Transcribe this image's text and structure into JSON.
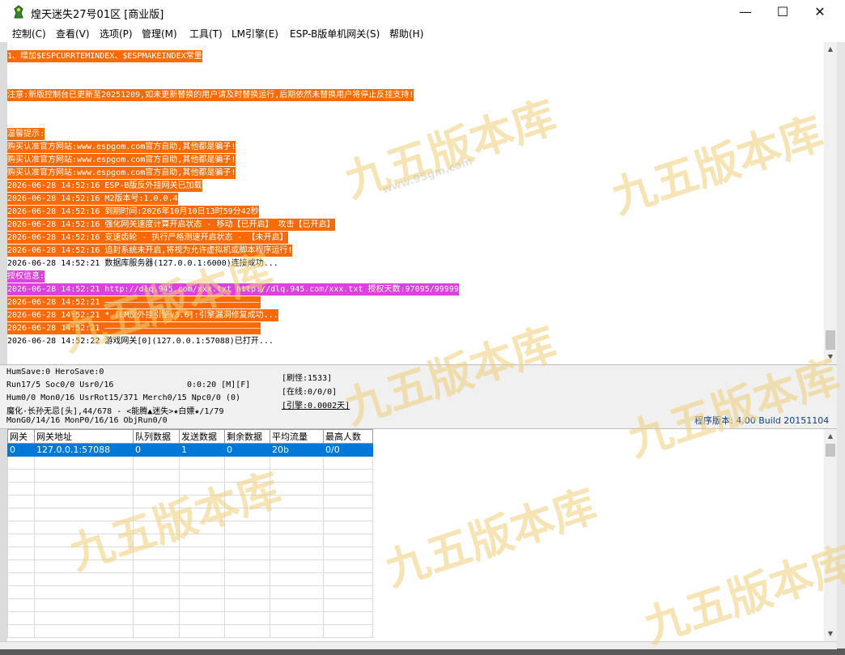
{
  "window": {
    "title": "煌天迷失27号01区 [商业版]",
    "minimize": "—",
    "maximize": "☐",
    "close": "✕"
  },
  "menu": [
    "控制(C)",
    "查看(V)",
    "选项(P)",
    "管理(M)",
    "工具(T)",
    "LM引擎(E)",
    "ESP-B版单机网关(S)",
    "帮助(H)"
  ],
  "log": [
    {
      "text": "1、增加$ESPCURRTEMINDEX、$ESPMAKEINDEX常量",
      "style": "o"
    },
    {
      "text": "",
      "style": "k"
    },
    {
      "text": "",
      "style": "k"
    },
    {
      "text": "注意:新版控制台已更新至20251209,如未更新替换的用户请及时替换运行,后期依然未替换用户将停止反挂支持!",
      "style": "o"
    },
    {
      "text": "",
      "style": "k"
    },
    {
      "text": "",
      "style": "k"
    },
    {
      "text": "温馨提示:",
      "style": "o"
    },
    {
      "text": "购买认准官方网站:www.espgom.com官方自助,其他都是骗子!",
      "style": "o"
    },
    {
      "text": "购买认准官方网站:www.espgom.com官方自助,其他都是骗子!",
      "style": "o"
    },
    {
      "text": "购买认准官方网站:www.espgom.com官方自助,其他都是骗子!",
      "style": "o"
    },
    {
      "text": "2026-06-28 14:52:16 ESP-B版反外挂网关已加载",
      "style": "o"
    },
    {
      "text": "2026-06-28 14:52:16 M2版本号:1.0.0.4",
      "style": "o"
    },
    {
      "text": "2026-06-28 14:52:16 到期时间:2026年10月10日13时59分42秒",
      "style": "o"
    },
    {
      "text": "2026-06-28 14:52:16 强化网关速度计算开启状态 - 移动【已开启】 攻击【已开启】",
      "style": "o"
    },
    {
      "text": "2026-06-28 14:52:16 变速齿轮 - 执行严格测速开启状态 - 【未开启】",
      "style": "o"
    },
    {
      "text": "2026-06-28 14:52:16 追封系统未开启,将视为允许虚拟机或脚本程序运行!",
      "style": "o"
    },
    {
      "text": "2026-06-28 14:52:21 数据库服务器(127.0.0.1:6000)连接成功...",
      "style": "k"
    },
    {
      "text": "授权信息:",
      "style": "m"
    },
    {
      "text": "2026-06-28 14:52:21 http://dlq.945.com/xxx.txt http://dlq.945.com/xxx.txt 授权天数:97095/99999",
      "style": "m"
    },
    {
      "text": "2026-06-28 14:52:21 ————————————————————————————————",
      "style": "o"
    },
    {
      "text": "2026-06-28 14:52:21 * [LM反外挂引擎v3.6]:引擎漏洞修复成功...",
      "style": "o"
    },
    {
      "text": "2026-06-28 14:52:21 ————————————————————————————————",
      "style": "o"
    },
    {
      "text": "2026-06-28 14:52:22 游戏网关[0](127.0.0.1:57088)已打开...",
      "style": "k"
    }
  ],
  "status": {
    "line1": "HumSave:0 HeroSave:0",
    "line2": "Run17/5 Soc0/0 Usr0/16",
    "time": "0:0:20 [M][F]",
    "line3": "Hum0/0 Mon0/16 UsrRot15/371 Merch0/15 Npc0/0 (0)",
    "line4": "魔化·长孙无忌[头],44/678 - <能腾▲迷失>★白嫖★/1/79",
    "line5": "MonG0/14/16 MonP0/16/16 ObjRun0/0",
    "refresh": "[刷怪:1533]",
    "online": "[在线:0/0/0]",
    "engine": "[引擎:0.0002天]",
    "version": "程序版本: 4.00 Build 20151104"
  },
  "table": {
    "headers": [
      "网关",
      "网关地址",
      "队列数据",
      "发送数据",
      "剩余数据",
      "平均流量",
      "最高人数"
    ],
    "rows": [
      [
        "0",
        "127.0.0.1:57088",
        "0",
        "1",
        "0",
        "20b",
        "0/0"
      ]
    ]
  },
  "watermark": "九五版本库",
  "watermark_url": "www.95gm.com"
}
